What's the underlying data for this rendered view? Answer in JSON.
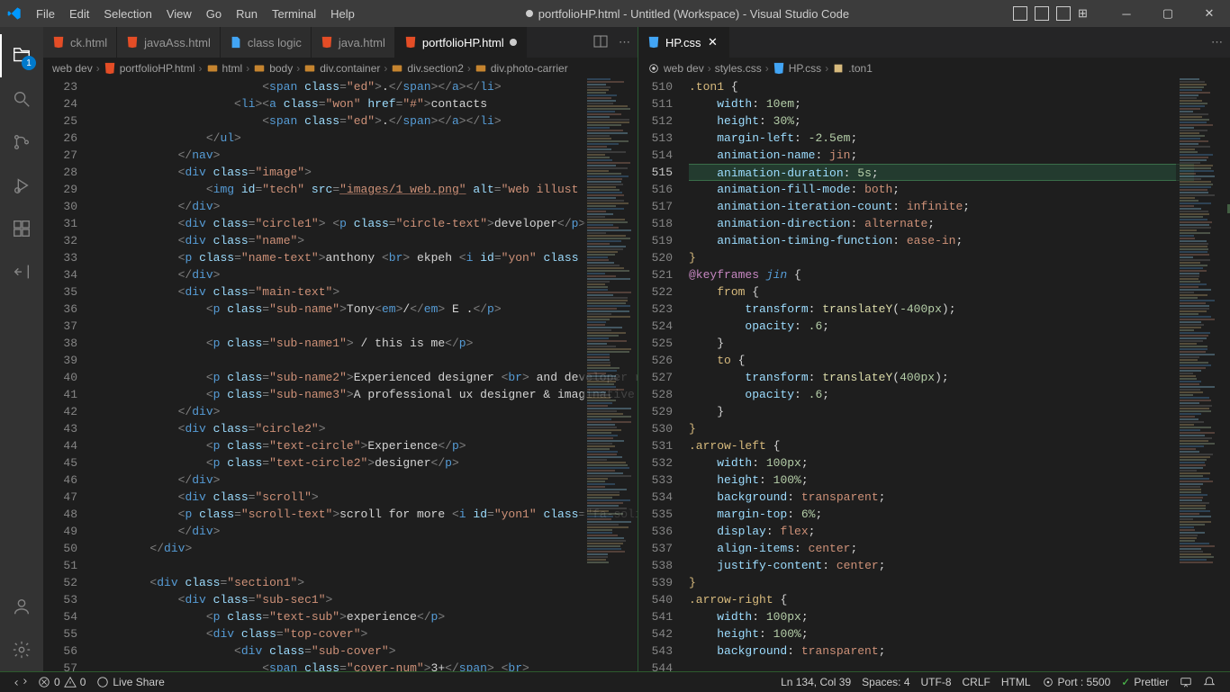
{
  "menu": [
    "File",
    "Edit",
    "Selection",
    "View",
    "Go",
    "Run",
    "Terminal",
    "Help"
  ],
  "title": "portfolioHP.html - Untitled (Workspace) - Visual Studio Code",
  "activity_badge": "1",
  "tabs_left": [
    {
      "name": "ck.html",
      "type": "html",
      "active": false,
      "modified": false
    },
    {
      "name": "javaAss.html",
      "type": "html",
      "active": false,
      "modified": false
    },
    {
      "name": "class logic",
      "type": "txt",
      "active": false,
      "modified": false
    },
    {
      "name": "java.html",
      "type": "html",
      "active": false,
      "modified": false
    },
    {
      "name": "portfolioHP.html",
      "type": "html",
      "active": true,
      "modified": true
    }
  ],
  "tabs_right": [
    {
      "name": "HP.css",
      "type": "css",
      "active": true,
      "modified": false
    }
  ],
  "breadcrumbs_left": [
    "web dev",
    "portfolioHP.html",
    "html",
    "body",
    "div.container",
    "div.section2",
    "div.photo-carrier"
  ],
  "breadcrumbs_right": [
    "web dev",
    "styles.css",
    "HP.css",
    ".ton1"
  ],
  "left_start_line": 23,
  "right_start_line": 510,
  "right_highlight_line": 515,
  "status": {
    "errors": "0",
    "warnings": "0",
    "liveshare": "Live Share",
    "pos": "Ln 134, Col 39",
    "spaces": "Spaces: 4",
    "encoding": "UTF-8",
    "eol": "CRLF",
    "lang": "HTML",
    "port": "Port : 5500",
    "prettier": "Prettier"
  }
}
